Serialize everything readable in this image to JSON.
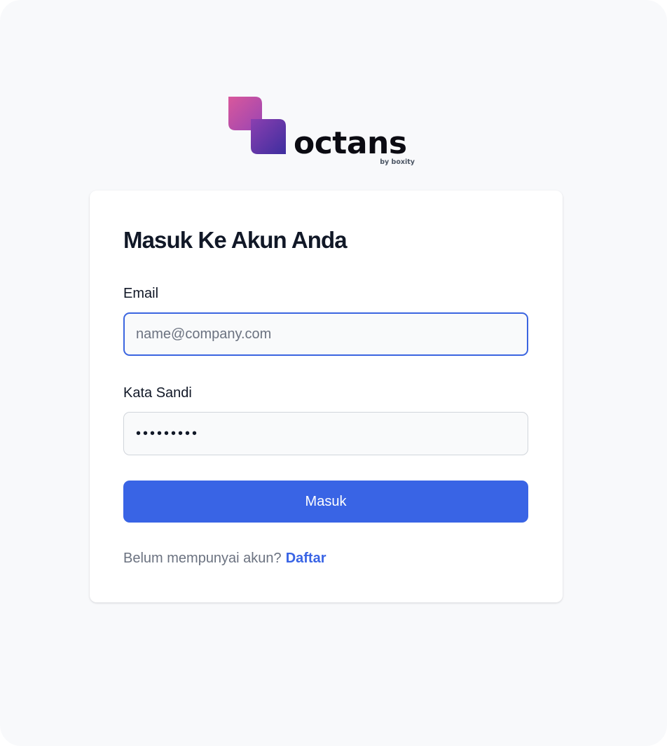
{
  "brand": {
    "name": "octans",
    "tagline": "by boxity",
    "colors": {
      "gradient_start": "#d6549b",
      "gradient_mid": "#8a3fb0",
      "gradient_end": "#4a30a6",
      "wordmark": "#0b0b12"
    }
  },
  "login": {
    "title": "Masuk Ke Akun Anda",
    "email": {
      "label": "Email",
      "placeholder": "name@company.com",
      "value": ""
    },
    "password": {
      "label": "Kata Sandi",
      "value": "•••••••••"
    },
    "submit_label": "Masuk",
    "signup_prompt": "Belum mempunyai akun?",
    "signup_link": "Daftar"
  },
  "colors": {
    "accent": "#3964e5",
    "background": "#f8f9fb",
    "card": "#ffffff",
    "text": "#111827",
    "muted": "#6b7280"
  }
}
